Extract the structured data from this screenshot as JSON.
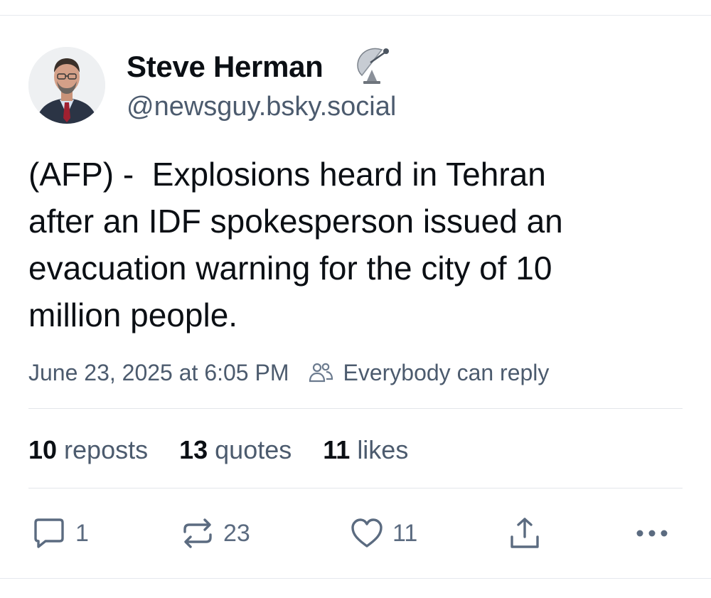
{
  "author": {
    "display_name": "Steve Herman",
    "handle": "@newsguy.bsky.social",
    "name_emoji": "satellite-dish-icon"
  },
  "post": {
    "text": "(AFP) -  Explosions heard in Tehran\nafter an IDF spokesperson issued an\nevacuation warning for the city of 10\nmillion people.",
    "timestamp": "June 23, 2025 at 6:05 PM",
    "reply_setting": "Everybody can reply"
  },
  "stats": {
    "reposts_count": "10",
    "reposts_label": "reposts",
    "quotes_count": "13",
    "quotes_label": "quotes",
    "likes_count": "11",
    "likes_label": "likes"
  },
  "actions": {
    "reply_count": "1",
    "repost_count": "23",
    "like_count": "11"
  },
  "colors": {
    "text": "#0b0f14",
    "muted": "#4c5b6e",
    "icon": "#5b6b80",
    "divider": "#e3e6ea"
  }
}
